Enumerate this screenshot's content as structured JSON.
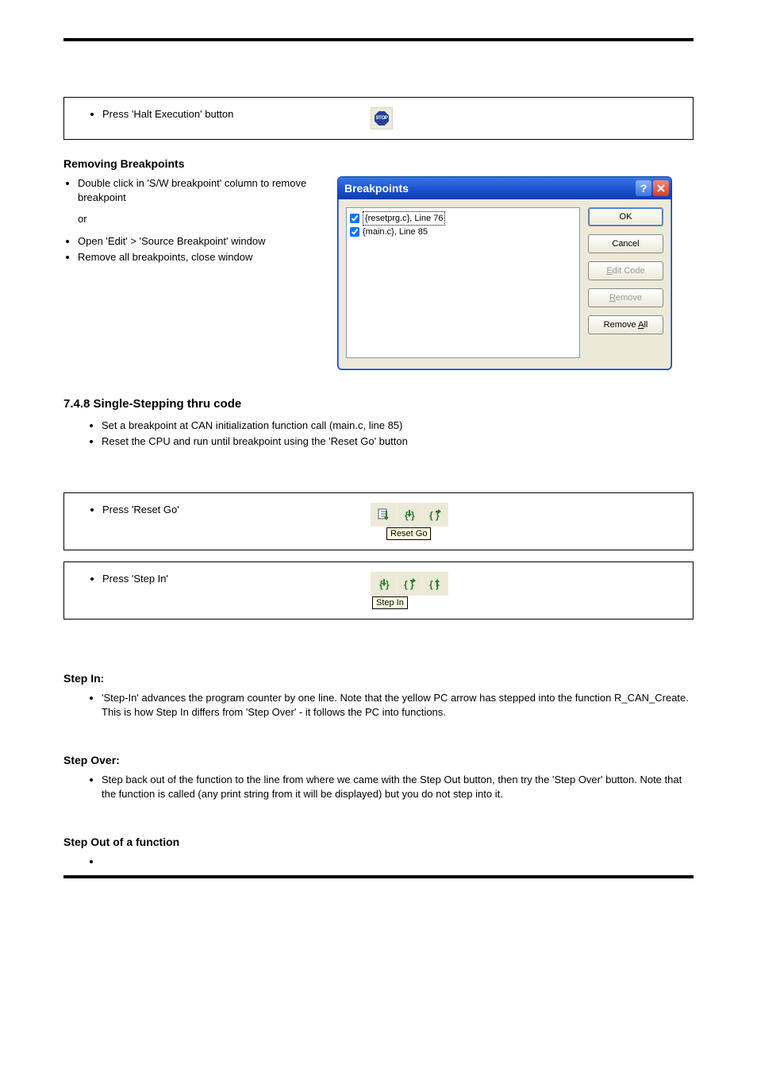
{
  "header": {
    "left": "",
    "right": ""
  },
  "halt_row": {
    "item": "Press 'Halt Execution' button",
    "icon_label": "STOP"
  },
  "remove_title": "Removing Breakpoints",
  "remove": {
    "bullets": [
      "Double click in 'S/W breakpoint' column to remove breakpoint",
      "or",
      "Open 'Edit' > 'Source Breakpoint' window",
      "Remove all breakpoints, close window"
    ]
  },
  "bp_dialog": {
    "title": "Breakpoints",
    "items": [
      {
        "checked": true,
        "text": "{resetprg.c}, Line 76"
      },
      {
        "checked": true,
        "text": "{main.c}, Line 85"
      }
    ],
    "buttons": {
      "ok": "OK",
      "cancel": "Cancel",
      "edit": "Edit Code",
      "remove": "Remove",
      "remove_all": "Remove All"
    }
  },
  "step_title": "7.4.8 Single-Stepping thru code",
  "step_intro_a": "Set a breakpoint at CAN initialization function call (main.c, line 85)",
  "step_intro_b": "Reset the CPU and run until breakpoint using the 'Reset Go' button",
  "resetgo_row": {
    "item": "Press 'Reset Go'",
    "tooltip": "Reset Go"
  },
  "stepin_row": {
    "item": "Press 'Step In'",
    "tooltip": "Step In"
  },
  "stepin_title": "Step In:",
  "stepin_body": "'Step-In' advances the program counter by one line. Note that the yellow PC arrow has stepped into the function R_CAN_Create. This is how Step In differs from 'Step Over' - it follows the PC into functions.",
  "stepover_title": "Step Over:",
  "stepover_body": "Step back out of the function to the line from where we came with the Step Out button, then try the 'Step Over' button. Note that the function is called (any print string from it will be displayed) but you do not step into it.",
  "stepout_title": "Step Out of a function",
  "footer": {
    "left": "",
    "right": ""
  }
}
